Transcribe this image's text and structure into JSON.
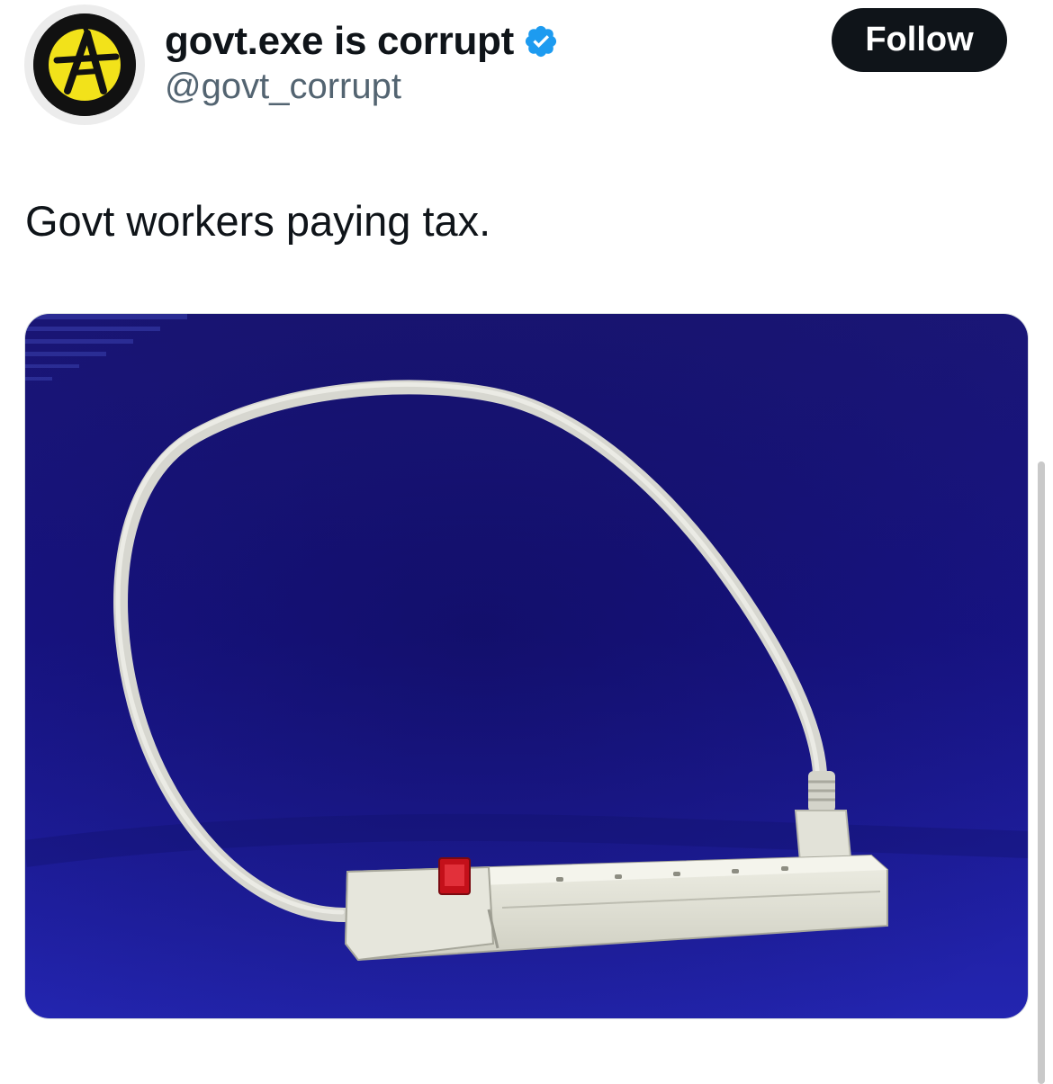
{
  "tweet": {
    "author": {
      "display_name": "govt.exe is corrupt",
      "handle": "@govt_corrupt",
      "verified": true,
      "avatar_icon": "anarchy-symbol-icon"
    },
    "follow_label": "Follow",
    "text": "Govt workers paying tax.",
    "media": {
      "description_icon": "power-strip-plugged-into-itself-photo"
    }
  },
  "colors": {
    "verified_blue": "#1d9bf0",
    "button_dark": "#0f1419",
    "handle_gray": "#536471",
    "avatar_yellow": "#f2e21a",
    "photo_blue": "#1c1a8c"
  }
}
